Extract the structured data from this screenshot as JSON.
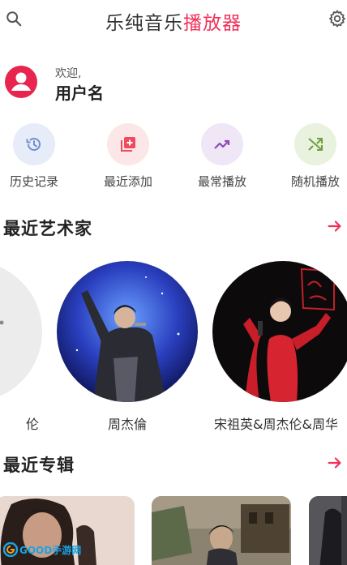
{
  "app": {
    "title_prefix": "乐纯音乐",
    "title_accent": "播放器"
  },
  "colors": {
    "accent": "#f0305a"
  },
  "welcome": {
    "greeting": "欢迎,",
    "username": "用户名"
  },
  "quick_actions": [
    {
      "label": "历史记录",
      "icon": "history-icon",
      "bg": "#e6ecf8",
      "fg": "#6f8fd0"
    },
    {
      "label": "最近添加",
      "icon": "recently-added-icon",
      "bg": "#fce6e8",
      "fg": "#ef4b5e"
    },
    {
      "label": "最常播放",
      "icon": "trending-icon",
      "bg": "#efe6f6",
      "fg": "#8e4bb8"
    },
    {
      "label": "随机播放",
      "icon": "shuffle-icon",
      "bg": "#e8f2df",
      "fg": "#6fa042"
    }
  ],
  "sections": {
    "recent_artists": "最近艺术家",
    "recent_albums": "最近专辑"
  },
  "artists": [
    {
      "name": "伦"
    },
    {
      "name": "周杰倫"
    },
    {
      "name": "宋祖英&周杰伦&周华"
    }
  ],
  "watermark": "GOOD手游网"
}
